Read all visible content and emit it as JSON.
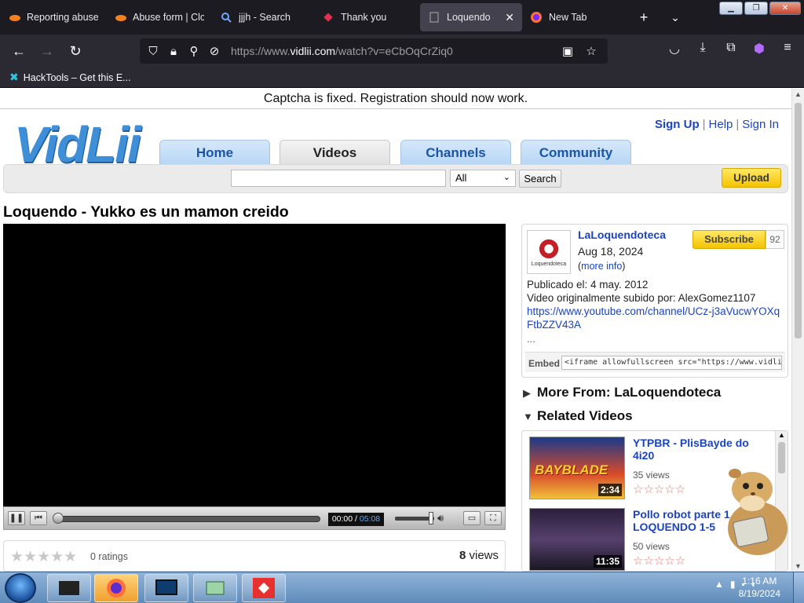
{
  "browser": {
    "tabs": [
      {
        "label": "Reporting abuse",
        "icon": "cloud-icon",
        "active": false
      },
      {
        "label": "Abuse form | Clo",
        "icon": "cloud-icon",
        "active": false
      },
      {
        "label": "jjjh - Search",
        "icon": "search-icon",
        "active": false
      },
      {
        "label": "Thank you",
        "icon": "diamond-icon",
        "active": false
      },
      {
        "label": "Loquendo - Yu",
        "icon": "page-icon",
        "active": true
      },
      {
        "label": "New Tab",
        "icon": "firefox-icon",
        "active": false
      }
    ],
    "url_prefix": "https://www.",
    "url_domain": "vidlii.com",
    "url_path": "/watch?v=eCbOqCrZiq0",
    "bookmark": "HackTools – Get this E..."
  },
  "page": {
    "notice": "Captcha is fixed. Registration should now work.",
    "logo": "VidLii",
    "toplinks": {
      "signup": "Sign Up",
      "help": "Help",
      "signin": "Sign In"
    },
    "nav": [
      "Home",
      "Videos",
      "Channels",
      "Community"
    ],
    "nav_selected": "Videos",
    "search": {
      "placeholder": "",
      "category": "All",
      "button": "Search"
    },
    "upload": "Upload",
    "video_title": "Loquendo - Yukko es un mamon creido",
    "player": {
      "current": "00:00",
      "total": "05:08",
      "sep": " / ",
      "progress": 0,
      "volume": 0.9
    },
    "ratings_text": "0 ratings",
    "rating_stars": 0,
    "views_count": "8",
    "views_label": "views",
    "channel": {
      "name": "LaLoquendoteca",
      "date": "Aug 18, 2024",
      "more_info": "more info",
      "subscribe": "Subscribe",
      "sub_count": "92",
      "avatar_label": "Loquendoteca"
    },
    "description": {
      "line1": "Publicado el: 4 may. 2012",
      "line2": "Video originalmente subido por: AlexGomez1107",
      "link": "https://www.youtube.com/channel/UCz-j3aVucwYOXqFtbZZV43A",
      "ellipsis": "..."
    },
    "embed": {
      "label": "Embed",
      "code": "<iframe allowfullscreen src=\"https://www.vidlii.com/embed?v"
    },
    "more_from": "More From: LaLoquendoteca",
    "related_heading": "Related Videos",
    "related": [
      {
        "title": "YTPBR - PlisBayde do 4i20",
        "views": "35 views",
        "duration": "2:34",
        "thumb_text": "BAYBLADE"
      },
      {
        "title": "Pollo robot parte 1 LOQUENDO 1-5",
        "views": "50 views",
        "duration": "11:35"
      }
    ]
  },
  "taskbar": {
    "time": "1:16 AM",
    "date": "8/19/2024"
  },
  "colors": {
    "link": "#1a44c1",
    "tab_blue": "#b7d6f5",
    "upload_yellow": "#f5c400",
    "browser_dark": "#1c1b22"
  }
}
